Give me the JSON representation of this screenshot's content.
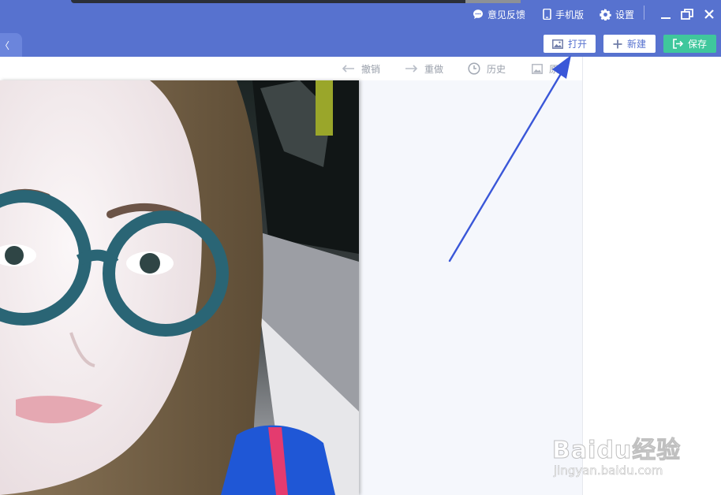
{
  "titlebar": {
    "feedback": "意见反馈",
    "mobile": "手机版",
    "settings": "设置"
  },
  "tab": {
    "label": "〈"
  },
  "actions": {
    "open": "打开",
    "new": "新建",
    "save": "保存"
  },
  "toolbar": {
    "undo": "撤销",
    "redo": "重做",
    "history": "历史",
    "original": "原图"
  },
  "watermark": {
    "brand": "Baidu经验",
    "url": "jingyan.baidu.com"
  },
  "colors": {
    "header": "#5772cf",
    "save": "#3fc79c",
    "annotation": "#3a57d8"
  },
  "icons": [
    "feedback-icon",
    "mobile-icon",
    "gear-icon",
    "minimize-icon",
    "restore-icon",
    "close-icon",
    "image-icon",
    "plus-icon",
    "export-icon",
    "undo-arrow-icon",
    "redo-arrow-icon",
    "clock-icon",
    "original-image-icon"
  ]
}
